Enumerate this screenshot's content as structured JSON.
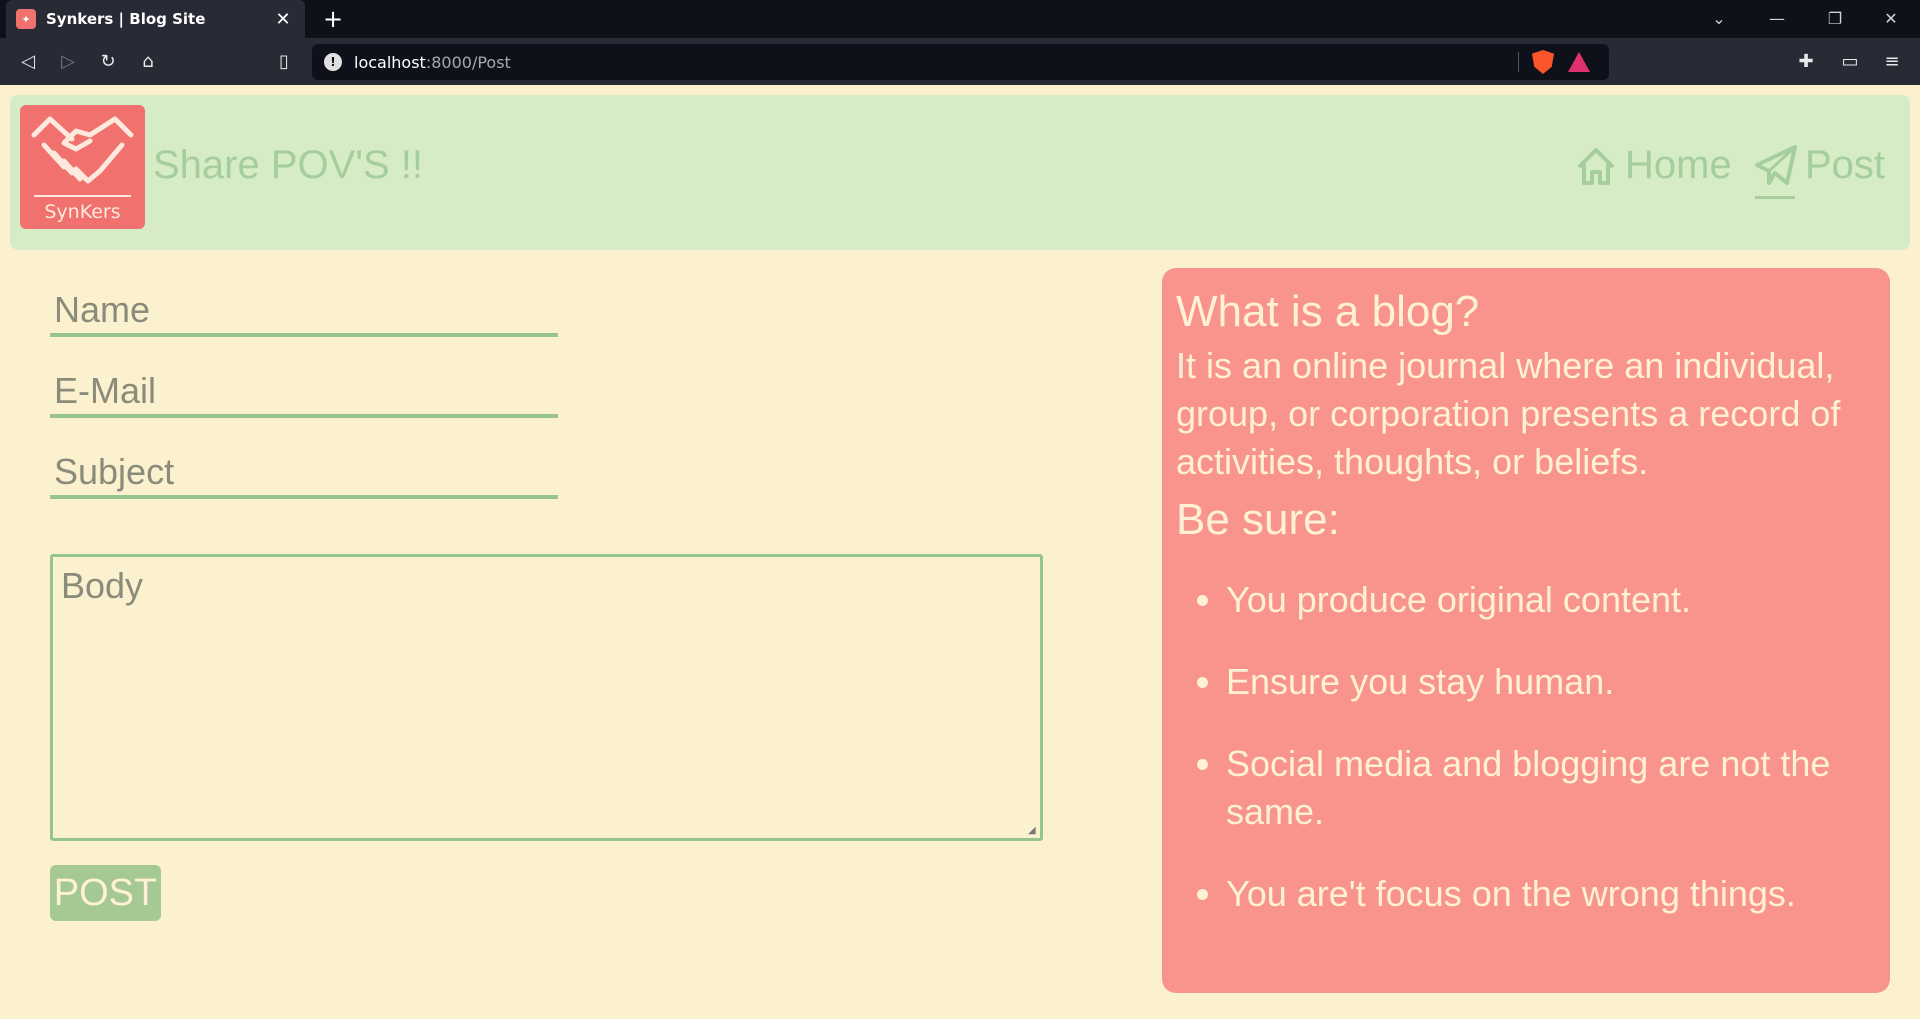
{
  "browser": {
    "tab_title": "Synkers | Blog Site",
    "tab_close": "✕",
    "new_tab": "+",
    "url_host": "localhost",
    "url_path": ":8000/Post"
  },
  "header": {
    "logo_text": "SynKers",
    "tagline": "Share POV'S !!",
    "nav": [
      {
        "label": "Home",
        "icon": "home-icon"
      },
      {
        "label": "Post",
        "icon": "paper-plane-icon"
      }
    ]
  },
  "form": {
    "name_placeholder": "Name",
    "email_placeholder": "E-Mail",
    "subject_placeholder": "Subject",
    "body_placeholder": "Body",
    "submit_label": "POST"
  },
  "info": {
    "title": "What is a blog?",
    "description": "It is an online journal where an individual, group, or corporation presents a record of activities, thoughts, or beliefs.",
    "subtitle": "Be sure:",
    "tips": [
      "You produce original content.",
      "Ensure you stay human.",
      "Social media and blogging are not the same.",
      "You are't focus on the wrong things."
    ]
  },
  "colors": {
    "page_bg": "#fbf1cf",
    "header_bg": "#d5ecc6",
    "accent_green": "#a6cd9c",
    "info_bg": "#f8948c",
    "logo_bg": "#f0716d"
  }
}
